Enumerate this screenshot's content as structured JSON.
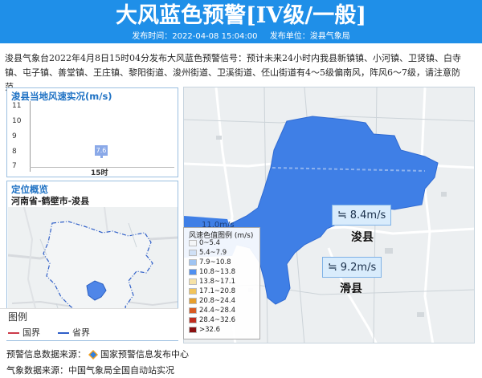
{
  "header": {
    "title": "大风蓝色预警[IV级/一般]",
    "publish_time": "发布时间：2022-04-08 15:04:00",
    "publisher": "发布单位：浚县气象局"
  },
  "description": "浚县气象台2022年4月8日15时04分发布大风蓝色预警信号：预计未来24小时内我县新镇镇、小河镇、卫贤镇、白寺镇、屯子镇、善堂镇、王庄镇、黎阳街道、浚州街道、卫溪街道、伾山街道有4～5级偏南风，阵风6～7级，请注意防范。",
  "wind_chart": {
    "title": "浚县当地风速实况(m/s)",
    "y_ticks": [
      "11",
      "10",
      "9",
      "8",
      "7"
    ],
    "x_label": "15时",
    "value_label": "7.6"
  },
  "chart_data": {
    "type": "bar",
    "categories": [
      "15时"
    ],
    "values": [
      7.6
    ],
    "title": "浚县当地风速实况(m/s)",
    "xlabel": "",
    "ylabel": "",
    "ylim": [
      7,
      11
    ]
  },
  "location": {
    "title": "定位概览",
    "path": "河南省-鹤壁市-浚县",
    "legend_title": "图例",
    "legend_items": [
      {
        "label": "国界",
        "color": "#cc3b4a"
      },
      {
        "label": "省界",
        "color": "#2f5fc8"
      }
    ]
  },
  "map": {
    "legend_title": "风速色值图例 (m/s)",
    "legend_items": [
      {
        "label": "0~5.4",
        "color": "#f4f6f8"
      },
      {
        "label": "5.4~7.9",
        "color": "#cfe0f6"
      },
      {
        "label": "7.9~10.8",
        "color": "#9fc4f2"
      },
      {
        "label": "10.8~13.8",
        "color": "#4f8ff0"
      },
      {
        "label": "13.8~17.1",
        "color": "#f6e2a6"
      },
      {
        "label": "17.1~20.8",
        "color": "#f2c45a"
      },
      {
        "label": "20.8~24.4",
        "color": "#e79f2d"
      },
      {
        "label": "24.4~28.4",
        "color": "#d85a22"
      },
      {
        "label": "28.4~32.6",
        "color": "#c02d1e"
      },
      {
        "label": ">32.6",
        "color": "#8a1010"
      }
    ],
    "stations": [
      {
        "speed": "8.4m/s",
        "city": "浚县"
      },
      {
        "speed": "9.2m/s",
        "city": "滑县"
      }
    ],
    "cut_label": "11.0m/s",
    "colors": {
      "warning_area": "#3f7fe6",
      "banner": "#1f8fe8"
    }
  },
  "footer": {
    "source1": "预警信息数据来源：",
    "source1_name": "国家预警信息发布中心",
    "source2": "气象数据来源：中国气象局全国自动站实况"
  }
}
